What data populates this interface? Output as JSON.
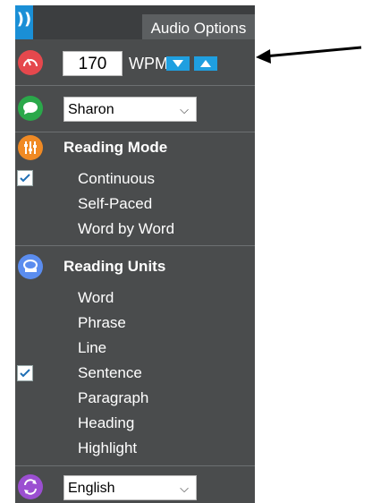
{
  "header": {
    "logo_glyph": "))",
    "tab_label": "Audio Options"
  },
  "rate": {
    "value": "170",
    "unit": "WPM"
  },
  "voice": {
    "selected": "Sharon"
  },
  "reading_mode": {
    "title": "Reading Mode",
    "options": [
      {
        "label": "Continuous",
        "checked": true
      },
      {
        "label": "Self-Paced",
        "checked": false
      },
      {
        "label": "Word by Word",
        "checked": false
      }
    ]
  },
  "reading_units": {
    "title": "Reading Units",
    "options": [
      {
        "label": "Word",
        "checked": false
      },
      {
        "label": "Phrase",
        "checked": false
      },
      {
        "label": "Line",
        "checked": false
      },
      {
        "label": "Sentence",
        "checked": true
      },
      {
        "label": "Paragraph",
        "checked": false
      },
      {
        "label": "Heading",
        "checked": false
      },
      {
        "label": "Highlight",
        "checked": false
      }
    ]
  },
  "language": {
    "selected": "English"
  },
  "colors": {
    "panel_bg": "#4a4c4d",
    "accent_blue": "#1f9fe0",
    "speed_icon": "#e5484d",
    "voice_icon": "#2aa84a",
    "mode_icon": "#f08a24",
    "units_icon": "#5b8def",
    "language_icon": "#9b4fd1"
  },
  "icons": {
    "speed": "speedometer-icon",
    "voice": "speech-bubble-icon",
    "mode": "sliders-icon",
    "units": "tape-measure-icon",
    "language": "translate-icon"
  }
}
